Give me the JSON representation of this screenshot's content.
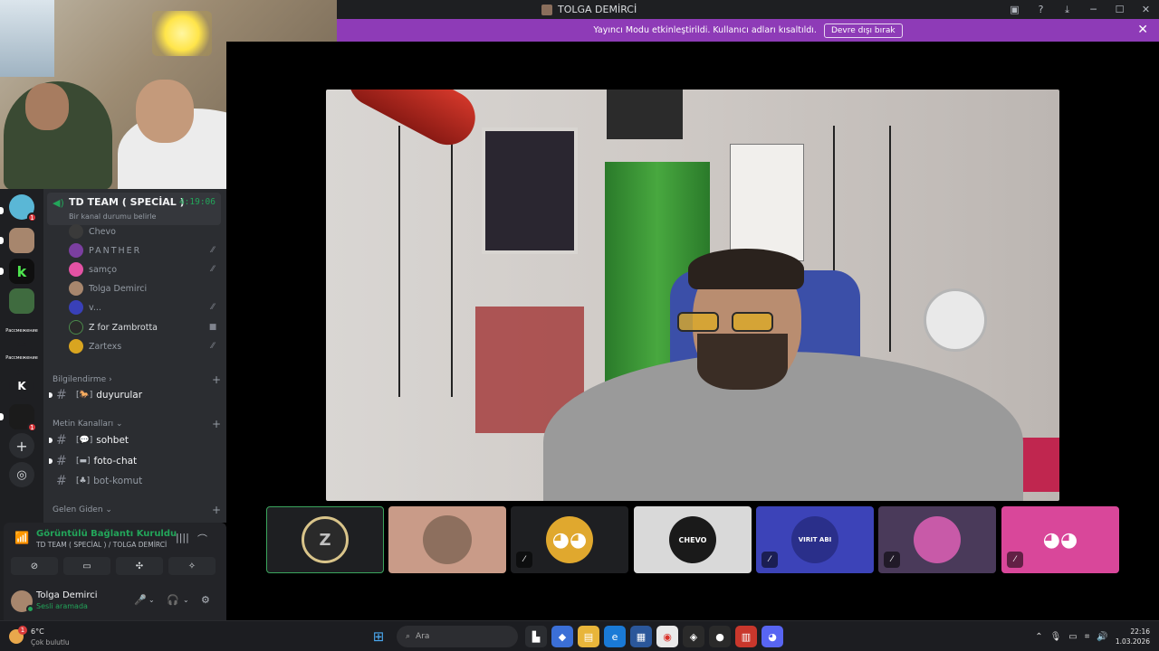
{
  "window": {
    "title": "TOLGA DEMİRCİ",
    "icons": [
      "screen-share-icon",
      "help-icon",
      "download-icon",
      "minimize-icon",
      "maximize-icon",
      "close-icon"
    ]
  },
  "notice": {
    "text": "Yayıncı Modu etkinleştirildi. Kullanıcı adları kısaltıldı.",
    "button": "Devre dışı bırak"
  },
  "servers": [
    {
      "label": "",
      "badge": "1"
    },
    {
      "label": "",
      "badge": ""
    },
    {
      "label": "k",
      "badge": ""
    },
    {
      "label": "",
      "badge": ""
    },
    {
      "label": "Рассмежение",
      "badge": ""
    },
    {
      "label": "Рассмежение",
      "badge": ""
    },
    {
      "label": "K",
      "badge": ""
    },
    {
      "label": "",
      "badge": "1"
    }
  ],
  "voice_channel": {
    "name": "TD TEAM ( SPECİAL )",
    "timer": "4:19:06",
    "status": "Bir kanal durumu belirle",
    "members": [
      {
        "name": "Chevo",
        "muted": false,
        "color": "#3a3a3a"
      },
      {
        "name": "PANTHER",
        "muted": true,
        "color": "#7b3fa0"
      },
      {
        "name": "samço",
        "muted": true,
        "color": "#e452a4"
      },
      {
        "name": "Tolga Demirci",
        "muted": false,
        "color": "#a7866d"
      },
      {
        "name": "v...",
        "muted": true,
        "color": "#3940b8"
      },
      {
        "name": "Z for Zambrotta",
        "muted": false,
        "color": "#2a2a2a",
        "camera": true
      },
      {
        "name": "Zartexs",
        "muted": true,
        "color": "#d9a520"
      }
    ]
  },
  "categories": {
    "info": "Bilgilendirme",
    "text": "Metin Kanalları",
    "incoming": "Gelen Giden"
  },
  "text_channels": {
    "announcements": "duyurular",
    "chat": "sohbet",
    "photo": "foto-chat",
    "bot": "bot-komut"
  },
  "voice_panel": {
    "connected": "Görüntülü Bağlantı Kuruldu",
    "location": "TD TEAM ( SPECİAL ) / TOLGA DEMİRCİ"
  },
  "user": {
    "name": "Tolga Demirci",
    "status": "Sesli aramada"
  },
  "tiles": [
    {
      "kind": "logo",
      "label": "",
      "muted": false,
      "bg": "#1e1f22"
    },
    {
      "kind": "face",
      "label": "",
      "muted": false,
      "bg": "#c99b88"
    },
    {
      "kind": "discord",
      "label": "",
      "muted": true,
      "bg": "#1e1f22"
    },
    {
      "kind": "chevo",
      "label": "CHEVO",
      "muted": false,
      "bg": "#d9d9d9"
    },
    {
      "kind": "virit",
      "label": "VIRIT ABI",
      "muted": true,
      "bg": "#3c43b8"
    },
    {
      "kind": "panther",
      "label": "",
      "muted": true,
      "bg": "#4a3a5a"
    },
    {
      "kind": "discord",
      "label": "",
      "muted": true,
      "bg": "#d9479a"
    }
  ],
  "taskbar": {
    "temp": "6°C",
    "weather": "Çok bulutlu",
    "weather_badge": "1",
    "search": "Ara",
    "time": "22:16",
    "date": "1.03.2026"
  }
}
